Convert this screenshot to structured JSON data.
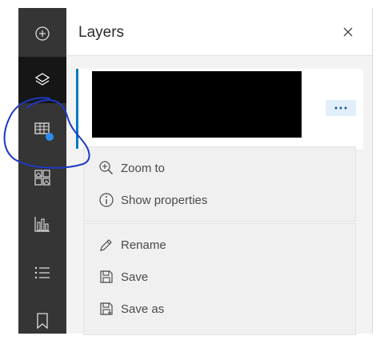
{
  "panel": {
    "title": "Layers",
    "close_icon": "close-icon"
  },
  "toolbar": {
    "items": [
      {
        "icon": "add-circle-icon",
        "active": false
      },
      {
        "icon": "layers-icon",
        "active": true
      },
      {
        "icon": "table-icon",
        "active": false,
        "badge": true
      },
      {
        "icon": "widgets-icon",
        "active": false
      },
      {
        "icon": "chart-icon",
        "active": false
      },
      {
        "icon": "list-icon",
        "active": false
      },
      {
        "icon": "bookmark-icon",
        "active": false
      }
    ]
  },
  "layer": {
    "more_icon": "more-icon"
  },
  "menu": {
    "group1": [
      {
        "label": "Zoom to",
        "icon": "zoom-in-icon"
      },
      {
        "label": "Show properties",
        "icon": "info-icon"
      }
    ],
    "group2": [
      {
        "label": "Rename",
        "icon": "pencil-icon"
      },
      {
        "label": "Save",
        "icon": "save-icon"
      },
      {
        "label": "Save as",
        "icon": "save-as-icon"
      }
    ]
  },
  "colors": {
    "accent": "#007ac2",
    "badge": "#2a8ee8",
    "toolbar_bg": "#353535",
    "toolbar_active": "#161616",
    "scribble": "#1d39c4"
  }
}
